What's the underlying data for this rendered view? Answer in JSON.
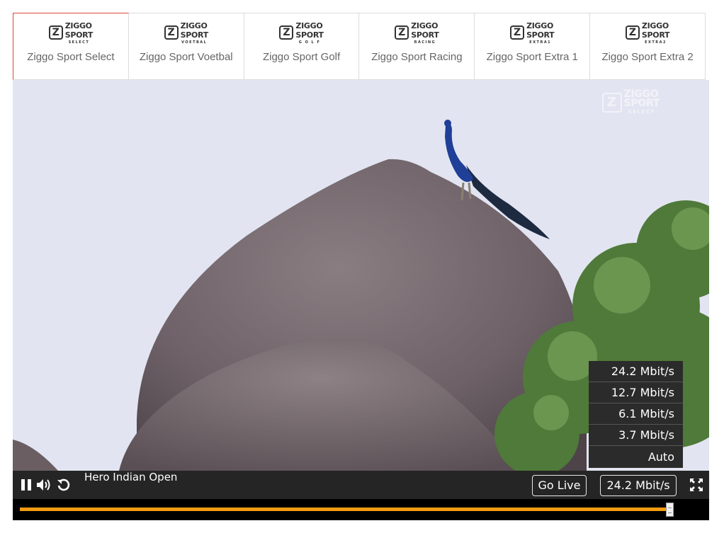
{
  "channels": [
    {
      "label": "Ziggo Sport Select",
      "logo_top": "ZIGGO",
      "logo_bottom": "SPORT",
      "logo_sub": "SELECT",
      "active": true
    },
    {
      "label": "Ziggo Sport Voetbal",
      "logo_top": "ZIGGO",
      "logo_bottom": "SPORT",
      "logo_sub": "VOETBAL",
      "active": false
    },
    {
      "label": "Ziggo Sport Golf",
      "logo_top": "ZIGGO",
      "logo_bottom": "SPORT",
      "logo_sub": "G O L F",
      "active": false
    },
    {
      "label": "Ziggo Sport Racing",
      "logo_top": "ZIGGO",
      "logo_bottom": "SPORT",
      "logo_sub": "RACING",
      "active": false
    },
    {
      "label": "Ziggo Sport Extra 1",
      "logo_top": "ZIGGO",
      "logo_bottom": "SPORT",
      "logo_sub": "EXTRA1",
      "active": false
    },
    {
      "label": "Ziggo Sport Extra 2",
      "logo_top": "ZIGGO",
      "logo_bottom": "SPORT",
      "logo_sub": "EXTRA2",
      "active": false
    }
  ],
  "player": {
    "watermark": {
      "top": "ZIGGO",
      "bottom": "SPORT",
      "sub": "SELECT"
    },
    "title": "Hero Indian Open",
    "go_live_label": "Go Live",
    "quality_button_label": "24.2 Mbit/s",
    "quality_options": [
      "24.2 Mbit/s",
      "12.7 Mbit/s",
      "6.1 Mbit/s",
      "3.7 Mbit/s",
      "Auto"
    ],
    "progress_fraction": 0.97,
    "accent_color": "#f39c12",
    "icons": [
      "pause-icon",
      "volume-icon",
      "replay-icon",
      "fullscreen-icon"
    ]
  }
}
